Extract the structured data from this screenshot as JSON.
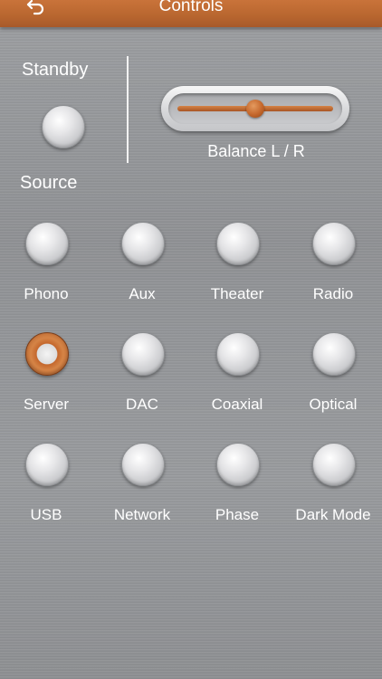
{
  "header": {
    "title": "Controls",
    "back_icon": "back-arrow-icon",
    "accent_color": "#c0692f"
  },
  "standby": {
    "label": "Standby"
  },
  "balance": {
    "label": "Balance  L / R",
    "value": 0.5
  },
  "source": {
    "label": "Source",
    "items": [
      {
        "label": "Phono",
        "active": false
      },
      {
        "label": "Aux",
        "active": false
      },
      {
        "label": "Theater",
        "active": false
      },
      {
        "label": "Radio",
        "active": false
      },
      {
        "label": "Server",
        "active": true
      },
      {
        "label": "DAC",
        "active": false
      },
      {
        "label": "Coaxial",
        "active": false
      },
      {
        "label": "Optical",
        "active": false
      },
      {
        "label": "USB",
        "active": false
      },
      {
        "label": "Network",
        "active": false
      },
      {
        "label": "Phase",
        "active": false
      },
      {
        "label": "Dark Mode",
        "active": false
      }
    ]
  }
}
